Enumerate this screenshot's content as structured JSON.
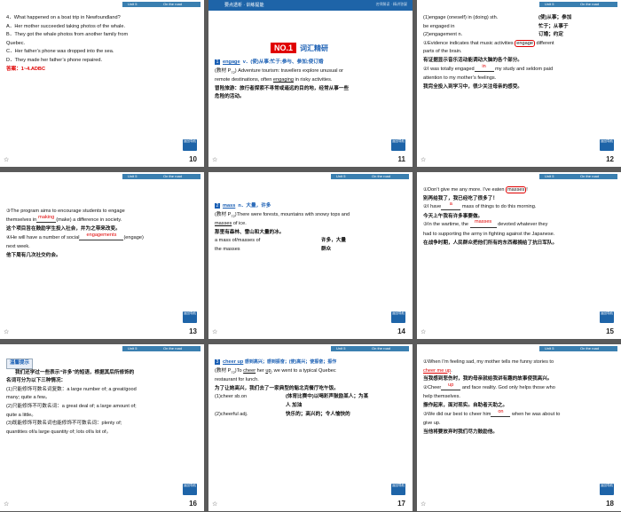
{
  "header": {
    "unit": "Unit 5",
    "section": "On the road"
  },
  "back_label": "返回导航",
  "star": "☆",
  "s10": {
    "num": "10",
    "q": "4．What happened on a boat trip in Newfoundland?",
    "a": "A．Her mother succeeded taking photos of the whale.",
    "b1": "B．They got the whale photos from another family from",
    "b2": "Quebec.",
    "c": "C．Her father’s phone was dropped into the sea.",
    "d": "D．They made her father’s phone repaired.",
    "ans": "答案：1~4.ADBC"
  },
  "s11": {
    "num": "11",
    "topbar": "要点透析 · 训练提能",
    "topbar_right": "名师解读 · 精讲答疑",
    "no": "NO.1",
    "title": "词汇精研",
    "icon": "1",
    "word": "engage",
    "def": "v．(使)从事;忙于;参与、参加;使订婚",
    "ex1": "(教材 P",
    "ex1_sub": "72",
    "ex1b": ") Adventure tourism: travellers explore unusual or",
    "ex2a": "remote destinations, often ",
    "ex2_kw": "engaging",
    "ex2b": " in risky activities.",
    "tr1": "冒险旅游：旅行者探索不寻常或遥远的目的地，经常从事一些",
    "tr2": "危险的活动。"
  },
  "s12": {
    "num": "12",
    "l1a": "(1)engage (oneself) in (doing) sth.",
    "l1b": "(使)从事；参加",
    "l2a": "be engaged in",
    "l2b": "忙于；从事于",
    "l3a": "(2)engagement n.",
    "l3b": "订婚；约定",
    "e1a": "①Evidence indicates that music activities ",
    "e1_kw": "engage",
    "e1b": " different",
    "e1c": "parts of the brain.",
    "e1t": "有证据显示音乐活动能调动大脑的各个部分。",
    "e2a": "②I was totally engaged",
    "e2_blank": "in",
    "e2b": " my study and seldom paid",
    "e2c": "attention to my mother’s feelings.",
    "e2t": "我完全投入到学习中，很少关注母亲的感受。"
  },
  "s13": {
    "num": "13",
    "l1": "③The program aims to encourage students to engage",
    "l2a": "themselves in",
    "l2_blank": "making",
    "l2b": "(make) a difference in society.",
    "l3": "这个项目旨在鼓励学生投入社会，并为之带来改变。",
    "l4a": "④He will have a number of social",
    "l4_blank": "engagements",
    "l4b": "(engage)",
    "l5": "next week.",
    "l6": "他下周有几次社交约会。"
  },
  "s14": {
    "num": "14",
    "icon": "2",
    "word": "mass",
    "def": "n．大量，许多",
    "ex1": "(教材 P",
    "ex1_sub": "72",
    "ex1b": ")There were forests, mountains with snowy tops and",
    "ex2_kw": "masses",
    "ex2b": " of ice.",
    "tr": "那里有森林、雪山和大量的冰。",
    "p1a": "a mass of/masses of",
    "p1b": "许多，大量",
    "p2a": "the masses",
    "p2b": "群众"
  },
  "s15": {
    "num": "15",
    "l1a": "①Don’t give me any more. I’ve eaten ",
    "l1_kw": "masses",
    "l1b": "!",
    "l1t": "别再给我了，我已经吃了很多了！",
    "l2a": "②I have",
    "l2_blank": "a",
    "l2b": " mass of things to do this morning.",
    "l2t": "今天上午我有许多事要做。",
    "l3a": "③In the wartime, the ",
    "l3_blank": "masses",
    "l3b": " devoted whatever they",
    "l3c": "had to supporting the army in fighting against the Japanese.",
    "l3t": "在战争时期，人民群众把他们所有的东西都捐给了抗日军队。"
  },
  "s16": {
    "num": "16",
    "tip": "温馨提示",
    "l1": "我们还学过一些表示“许多”的短语，根据其后所修饰的",
    "l2": "名词可分为以下三种情况：",
    "l3": "(1)只能修饰可数名词复数：a large number of; a great/good",
    "l4": "many; quite a few。",
    "l5": "(2)只能修饰不可数名词：a great deal of; a large amount of;",
    "l6": "quite a little。",
    "l7": "(3)既能修饰可数名词也能修饰不可数名词：plenty of;",
    "l8": "quantities of/a large quantity of; lots of/a lot of。"
  },
  "s17": {
    "num": "17",
    "icon": "3",
    "word": "cheer up",
    "def": "感到高兴；感到振奋；(使)高兴；使振奋；振作",
    "ex1": "(教材 P",
    "ex1_sub": "72",
    "ex1b": ")To ",
    "ex1_kw1": "cheer",
    "ex1c": " her ",
    "ex1_kw2": "up",
    "ex1d": ", we went to a typical Quebec",
    "ex2": "restaurant for lunch.",
    "tr": "为了让她高兴，我们去了一家典型的魁北克餐厅吃午饭。",
    "p1a": "(1)cheer sb.on",
    "p1b": "(体育比赛中)以喝彩声鼓励某人；为某",
    "p1c": "人  加油",
    "p2a": "(2)cheerful adj.",
    "p2b": "快乐的；高兴的；令人愉快的"
  },
  "s18": {
    "num": "18",
    "l1": "①When I’m feeling sad, my mother tells me funny stories to",
    "l2_kw": "cheer me up",
    "l2b": ".",
    "l2t": "当我感到悲伤时，我的母亲就给我讲有趣的故事使我高兴。",
    "l3a": "②Cheer",
    "l3_blank": "up",
    "l3b": " and face reality. God only helps those who",
    "l3c": "help themselves.",
    "l3t": "振作起来，面对现实。自助者天助之。",
    "l4a": "③We did our best to cheer him",
    "l4_blank": "on",
    "l4b": " when he was about to",
    "l4c": "give up.",
    "l4t": "当他将要放弃时我们尽力鼓励他。"
  }
}
